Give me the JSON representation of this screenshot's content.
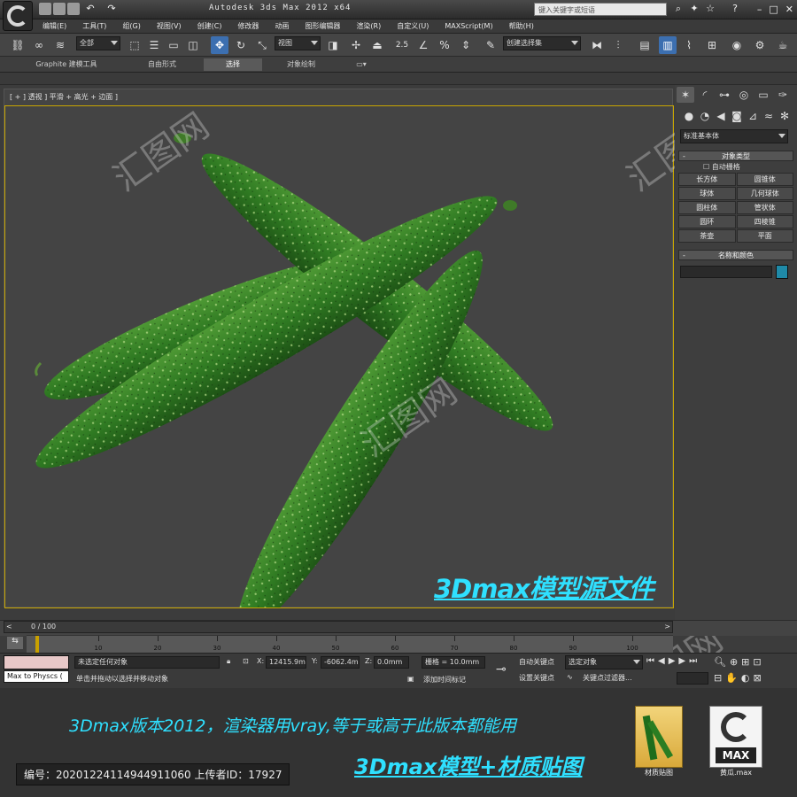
{
  "app": {
    "title": "Autodesk 3ds Max  2012 x64",
    "search_placeholder": "键入关键字或短语"
  },
  "menu": [
    "编辑(E)",
    "工具(T)",
    "组(G)",
    "视图(V)",
    "创建(C)",
    "修改器",
    "动画",
    "图形编辑器",
    "渲染(R)",
    "自定义(U)",
    "MAXScript(M)",
    "帮助(H)"
  ],
  "toolbar": {
    "selection_filter": "全部",
    "ref_coord": "视图",
    "named_selection": "创建选择集",
    "snap_value": "2.5"
  },
  "ribbon": {
    "tabs": [
      "Graphite 建模工具",
      "自由形式",
      "选择",
      "对象绘制"
    ],
    "selected": "选择"
  },
  "viewport": {
    "label": "[ + ] 透视 ] 平滑 + 高光 + 边面 ]",
    "overlay_text": "3Dmax模型源文件",
    "watermark": "汇图网"
  },
  "command_panel": {
    "category": "标准基本体",
    "object_type_header": "对象类型",
    "auto_grid": "自动栅格",
    "objects": [
      "长方体",
      "圆锥体",
      "球体",
      "几何球体",
      "圆柱体",
      "管状体",
      "圆环",
      "四棱锥",
      "茶壶",
      "平面"
    ],
    "name_color_header": "名称和颜色",
    "name_value": "",
    "swatch_color": "#1f8aa8"
  },
  "timeline": {
    "frame_label": "0 / 100",
    "ticks": [
      "0",
      "10",
      "20",
      "30",
      "40",
      "50",
      "60",
      "70",
      "80",
      "90",
      "100"
    ]
  },
  "status": {
    "maxscript": "Max to Physcs (",
    "selection": "未选定任何对象",
    "prompt": "单击并拖动以选择并移动对象",
    "x_label": "X:",
    "x_value": "12415.9m",
    "y_label": "Y:",
    "y_value": "-6062.4mm",
    "z_label": "Z:",
    "z_value": "0.0mm",
    "grid": "栅格 = 10.0mm",
    "add_time_tag": "添加时间标记",
    "auto_key": "自动关键点",
    "set_key": "设置关键点",
    "key_filter": "选定对象",
    "key_filters_label": "关键点过滤器..."
  },
  "lower": {
    "version_line": "3Dmax版本2012，渲染器用vray,等于或高于此版本都能用",
    "model_line": "3Dmax模型+材质贴图",
    "id_line": "编号：20201224114944911060 上传者ID：17927",
    "folder_label": "材质贴图",
    "file_label": "黄瓜.max",
    "max_badge": "MAX"
  }
}
